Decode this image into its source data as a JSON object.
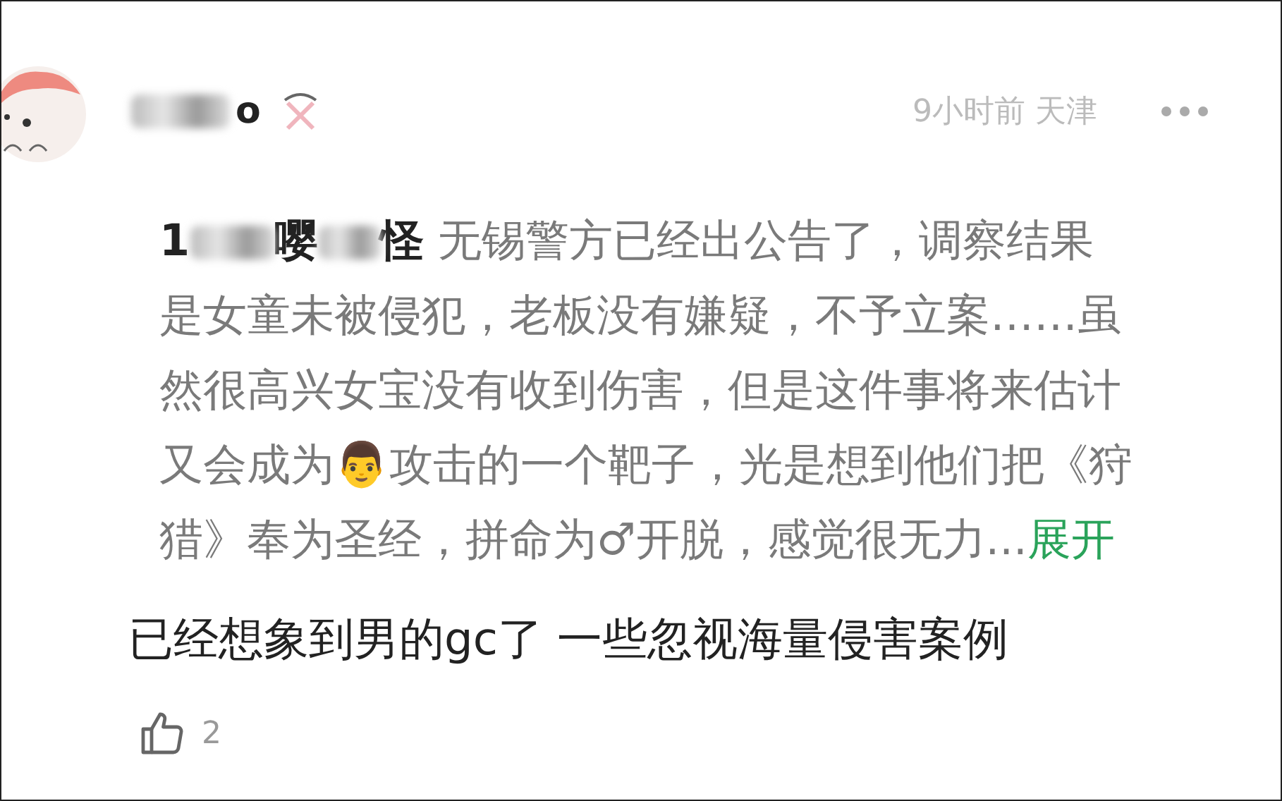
{
  "comment": {
    "author": "o",
    "time": "9小时前",
    "location": "天津",
    "reply": {
      "mention_parts": [
        "1",
        "嘤",
        "怪"
      ],
      "lines": [
        "无锡警方已经出公告了，调察结果",
        "是女童未被侵犯，老板没有嫌疑，不予立案……虽",
        "然很高兴女宝没有收到伤害，但是这件事将来估计",
        "又会成为👨攻击的一个靶子，光是想到他们把《狩",
        "猎》奉为圣经，拼命为♂开脱，感觉很无力..."
      ],
      "expand": "展开"
    },
    "body": "已经想象到男的gc了 一些忽视海量侵害案例",
    "likes": "2"
  }
}
